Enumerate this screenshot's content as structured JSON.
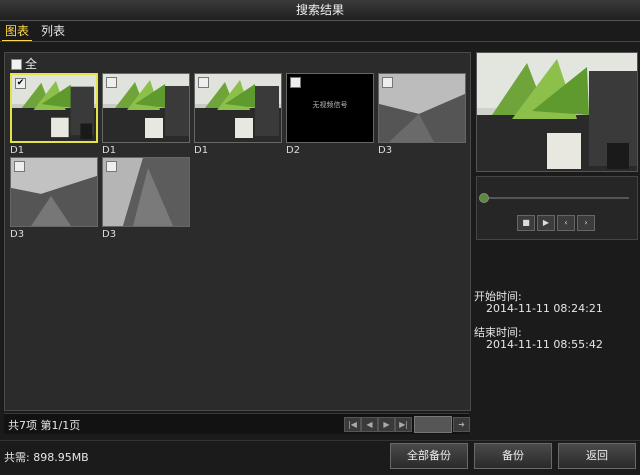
{
  "window": {
    "title": "搜索结果"
  },
  "tabs": [
    {
      "label": "图表"
    },
    {
      "label": "列表"
    }
  ],
  "gallery": {
    "select_all_label": "全",
    "thumbnails": [
      {
        "channel": "D1",
        "checked": true
      },
      {
        "channel": "D1",
        "checked": false
      },
      {
        "channel": "D1",
        "checked": false
      },
      {
        "channel": "D2",
        "checked": false,
        "overlay_text": "无视频信号"
      },
      {
        "channel": "D3",
        "checked": false
      },
      {
        "channel": "D3",
        "checked": false
      },
      {
        "channel": "D3",
        "checked": false
      }
    ]
  },
  "pager": {
    "info": "共7项 第1/1页"
  },
  "details": {
    "start_label": "开始时间:",
    "start_value": "2014-11-11 08:24:21",
    "end_label": "结束时间:",
    "end_value": "2014-11-11 08:55:42"
  },
  "footer": {
    "total": "共需: 898.95MB",
    "backup_all": "全部备份",
    "backup": "备份",
    "back": "返回"
  },
  "colors": {
    "accent": "#ffd84a",
    "selected_border": "#e3e34a"
  }
}
